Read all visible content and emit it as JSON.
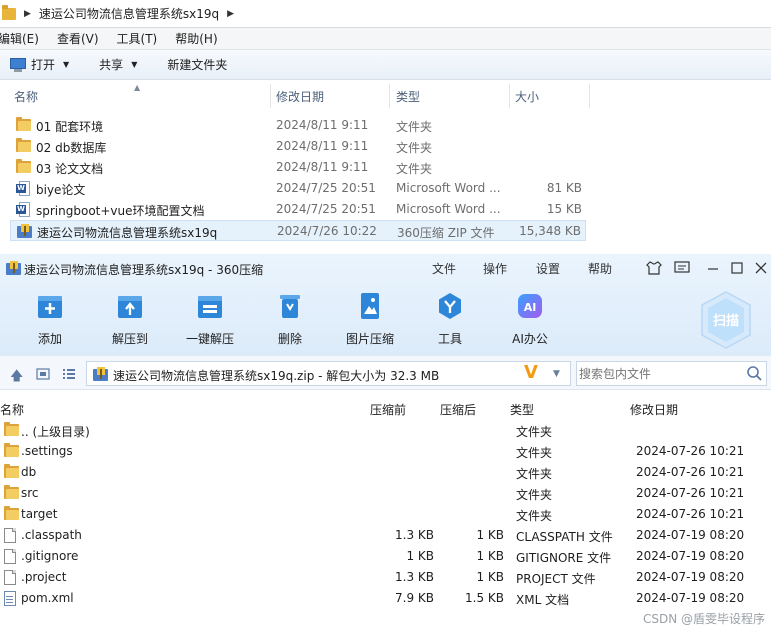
{
  "explorer": {
    "path": "速运公司物流信息管理系统sx19q",
    "menu": [
      "编辑(E)",
      "查看(V)",
      "工具(T)",
      "帮助(H)"
    ],
    "toolbar": {
      "open": "打开",
      "share": "共享",
      "new_folder": "新建文件夹"
    },
    "columns": {
      "name": "名称",
      "date": "修改日期",
      "type": "类型",
      "size": "大小"
    },
    "files": [
      {
        "icon": "folder",
        "name": "01 配套环境",
        "date": "2024/8/11 9:11",
        "type": "文件夹",
        "size": ""
      },
      {
        "icon": "folder",
        "name": "02 db数据库",
        "date": "2024/8/11 9:11",
        "type": "文件夹",
        "size": ""
      },
      {
        "icon": "folder",
        "name": "03 论文文档",
        "date": "2024/8/11 9:11",
        "type": "文件夹",
        "size": ""
      },
      {
        "icon": "word",
        "name": "biye论文",
        "date": "2024/7/25 20:51",
        "type": "Microsoft Word ...",
        "size": "81 KB"
      },
      {
        "icon": "word",
        "name": "springboot+vue环境配置文档",
        "date": "2024/7/25 20:51",
        "type": "Microsoft Word ...",
        "size": "15 KB"
      },
      {
        "icon": "zip",
        "name": "速运公司物流信息管理系统sx19q",
        "date": "2024/7/26 10:22",
        "type": "360压缩 ZIP 文件",
        "size": "15,348 KB"
      }
    ]
  },
  "zip": {
    "title": "速运公司物流信息管理系统sx19q - 360压缩",
    "menu": [
      "文件",
      "操作",
      "设置",
      "帮助"
    ],
    "toolbar": [
      "添加",
      "解压到",
      "一键解压",
      "删除",
      "图片压缩",
      "工具",
      "AI办公"
    ],
    "scan_label": "扫描",
    "path_text": "速运公司物流信息管理系统sx19q.zip - 解包大小为 32.3 MB",
    "search_placeholder": "搜索包内文件",
    "columns": {
      "name": "名称",
      "compressed": "压缩前",
      "uncompressed": "压缩后",
      "type": "类型",
      "date": "修改日期"
    },
    "entries": [
      {
        "icon": "folder",
        "name": ".. (上级目录)",
        "before": "",
        "after": "",
        "type": "文件夹",
        "date": ""
      },
      {
        "icon": "folder",
        "name": ".settings",
        "before": "",
        "after": "",
        "type": "文件夹",
        "date": "2024-07-26 10:21"
      },
      {
        "icon": "folder",
        "name": "db",
        "before": "",
        "after": "",
        "type": "文件夹",
        "date": "2024-07-26 10:21"
      },
      {
        "icon": "folder",
        "name": "src",
        "before": "",
        "after": "",
        "type": "文件夹",
        "date": "2024-07-26 10:21"
      },
      {
        "icon": "folder",
        "name": "target",
        "before": "",
        "after": "",
        "type": "文件夹",
        "date": "2024-07-26 10:21"
      },
      {
        "icon": "file",
        "name": ".classpath",
        "before": "1.3 KB",
        "after": "1 KB",
        "type": "CLASSPATH 文件",
        "date": "2024-07-19 08:20"
      },
      {
        "icon": "file",
        "name": ".gitignore",
        "before": "1 KB",
        "after": "1 KB",
        "type": "GITIGNORE 文件",
        "date": "2024-07-19 08:20"
      },
      {
        "icon": "file",
        "name": ".project",
        "before": "1.3 KB",
        "after": "1 KB",
        "type": "PROJECT 文件",
        "date": "2024-07-19 08:20"
      },
      {
        "icon": "xml",
        "name": "pom.xml",
        "before": "7.9 KB",
        "after": "1.5 KB",
        "type": "XML 文档",
        "date": "2024-07-19 08:20"
      }
    ]
  },
  "watermark": "CSDN @盾雯毕设程序"
}
